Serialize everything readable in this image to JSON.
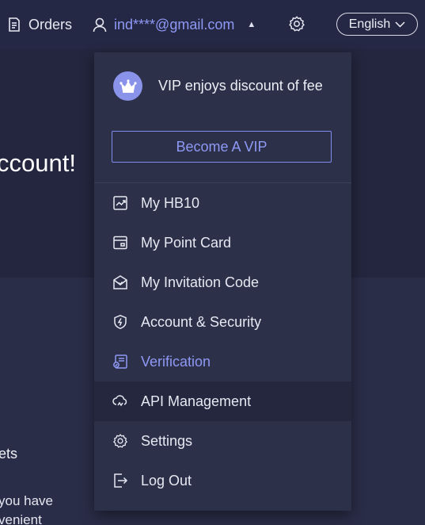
{
  "topbar": {
    "orders_label": "Orders",
    "user_email": "ind****@gmail.com",
    "language": "English"
  },
  "background": {
    "hero_text": "ccount!",
    "section_title": "ets",
    "paragraph_line1": "you have",
    "paragraph_line2": "venient"
  },
  "dropdown": {
    "vip_text": "VIP enjoys discount of fee",
    "become_vip_label": "Become A VIP",
    "items": [
      {
        "label": "My HB10",
        "icon": "chart-icon"
      },
      {
        "label": "My Point Card",
        "icon": "card-icon"
      },
      {
        "label": "My Invitation Code",
        "icon": "gift-icon"
      },
      {
        "label": "Account & Security",
        "icon": "shield-icon"
      },
      {
        "label": "Verification",
        "icon": "id-card-icon",
        "active": true
      },
      {
        "label": "API Management",
        "icon": "api-icon",
        "hovered": true
      },
      {
        "label": "Settings",
        "icon": "gear-icon"
      },
      {
        "label": "Log Out",
        "icon": "logout-icon"
      }
    ]
  },
  "colors": {
    "accent": "#8e99f5",
    "background": "#1f2137",
    "dropdown": "#2d3049",
    "hover": "#24273e"
  }
}
